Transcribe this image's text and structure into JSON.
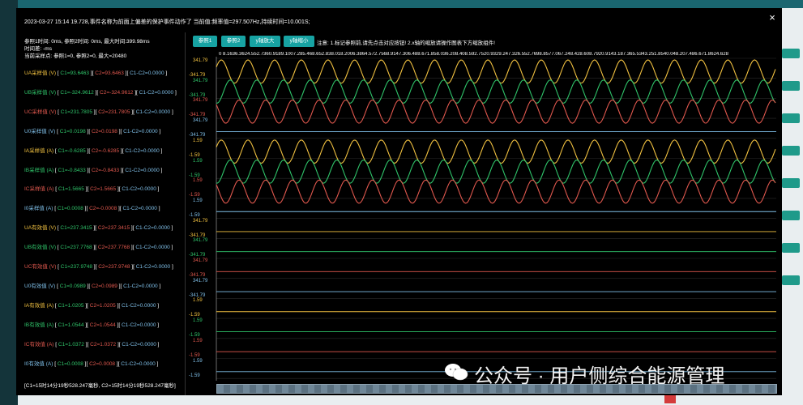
{
  "dialog": {
    "title": "2023-03-27 15:14 19.728,事件名称为前面上偏差的保护事件动作了 当前值:频率值=297.507Hz,持续时间=10.001S;",
    "close_label": "×",
    "info_lines": [
      "参照1时间:  0ms,  参照2时间:  0ms,  最大时间:399.98ms",
      "时间差:  -ms",
      "当前采样点:  参照1=0,  参照2=0,  最大=20480"
    ],
    "channels": [
      {
        "name": "UA采样值 (V)",
        "c1": "C1=93.6463",
        "c2": "C2=93.6463",
        "diff": "C1-C2=0.0000",
        "color": "#f0c040"
      },
      {
        "name": "UB采样值 (V)",
        "c1": "C1=-324.9612",
        "c2": "C2=-324.9612",
        "diff": "C1-C2=0.0000",
        "color": "#2fc46a"
      },
      {
        "name": "UC采样值 (V)",
        "c1": "C1=231.7805",
        "c2": "C2=231.7805",
        "diff": "C1-C2=0.0000",
        "color": "#e0584e"
      },
      {
        "name": "U0采样值 (V)",
        "c1": "C1=0.0198",
        "c2": "C2=0.0198",
        "diff": "C1-C2=0.0000",
        "color": "#7fbfe8"
      },
      {
        "name": "IA采样值 (A)",
        "c1": "C1=-0.6285",
        "c2": "C2=-0.6285",
        "diff": "C1-C2=0.0000",
        "color": "#f0c040"
      },
      {
        "name": "IB采样值 (A)",
        "c1": "C1=-0.8433",
        "c2": "C2=-0.8433",
        "diff": "C1-C2=0.0000",
        "color": "#2fc46a"
      },
      {
        "name": "IC采样值 (A)",
        "c1": "C1=1.5665",
        "c2": "C2=1.5665",
        "diff": "C1-C2=0.0000",
        "color": "#e0584e"
      },
      {
        "name": "I0采样值 (A)",
        "c1": "C1=0.0008",
        "c2": "C2=-0.0008",
        "diff": "C1-C2=0.0000",
        "color": "#7fbfe8"
      },
      {
        "name": "UA有效值 (V)",
        "c1": "C1=237.3415",
        "c2": "C2=237.3415",
        "diff": "C1-C2=0.0000",
        "color": "#f0c040"
      },
      {
        "name": "UB有效值 (V)",
        "c1": "C1=237.7768",
        "c2": "C2=237.7768",
        "diff": "C1-C2=0.0000",
        "color": "#2fc46a"
      },
      {
        "name": "UC有效值 (V)",
        "c1": "C1=237.9748",
        "c2": "C2=237.9748",
        "diff": "C1-C2=0.0000",
        "color": "#e0584e"
      },
      {
        "name": "U0有效值 (V)",
        "c1": "C1=0.0989",
        "c2": "C2=0.0989",
        "diff": "C1-C2=0.0000",
        "color": "#7fbfe8"
      },
      {
        "name": "IA有效值 (A)",
        "c1": "C1=1.0205",
        "c2": "C2=1.0205",
        "diff": "C1-C2=0.0000",
        "color": "#f0c040"
      },
      {
        "name": "IB有效值 (A)",
        "c1": "C1=1.0544",
        "c2": "C2=1.0544",
        "diff": "C1-C2=0.0000",
        "color": "#2fc46a"
      },
      {
        "name": "IC有效值 (A)",
        "c1": "C1=1.0372",
        "c2": "C2=1.0372",
        "diff": "C1-C2=0.0000",
        "color": "#e0584e"
      },
      {
        "name": "I0有效值 (A)",
        "c1": "C1=0.0008",
        "c2": "C2=0.0008",
        "diff": "C1-C2=0.0000",
        "color": "#7fbfe8"
      }
    ],
    "bottom_text": "[C1=15时14分19秒528.247毫秒,  C2=15时14分19秒528.247毫秒]",
    "toolbar": {
      "ref1": "参照1",
      "ref2": "参照2",
      "y_zoom_in": "y轴放大",
      "y_zoom_out": "y轴缩小",
      "note": "注意: 1.标记参照前,请先点击对应按钮! 2.x轴的缩放请操作图表下方缩放组件!"
    },
    "x_axis_text": "0  8.1636.3624.552.7360.9189.1007.285.468.652.838.018.2006.3864.572.7568.9147.306.488.671.858.036.208.408.592.7520.9329.247.326.552.7698.8577.067.248.428.608.7920.9143.187.365.5343.251.8540.048.207.486.671.8624.628",
    "y_labels": [
      {
        "text": "341.79",
        "color": "#f0c040"
      },
      {
        "text": "-341.79",
        "color": "#f0c040"
      },
      {
        "text": "341.79",
        "color": "#2fc46a"
      },
      {
        "text": "-341.79",
        "color": "#2fc46a"
      },
      {
        "text": "341.79",
        "color": "#e0584e"
      },
      {
        "text": "-341.79",
        "color": "#e0584e"
      },
      {
        "text": "341.79",
        "color": "#7fbfe8"
      },
      {
        "text": "-341.79",
        "color": "#7fbfe8"
      },
      {
        "text": "1.59",
        "color": "#f0c040"
      },
      {
        "text": "-1.59",
        "color": "#f0c040"
      },
      {
        "text": "1.59",
        "color": "#2fc46a"
      },
      {
        "text": "-1.59",
        "color": "#2fc46a"
      },
      {
        "text": "1.59",
        "color": "#e0584e"
      },
      {
        "text": "-1.59",
        "color": "#e0584e"
      },
      {
        "text": "1.59",
        "color": "#7fbfe8"
      },
      {
        "text": "-1.59",
        "color": "#7fbfe8"
      },
      {
        "text": "341.79",
        "color": "#f0c040"
      },
      {
        "text": "-341.79",
        "color": "#f0c040"
      },
      {
        "text": "341.79",
        "color": "#2fc46a"
      },
      {
        "text": "-341.79",
        "color": "#2fc46a"
      },
      {
        "text": "341.79",
        "color": "#e0584e"
      },
      {
        "text": "-341.79",
        "color": "#e0584e"
      },
      {
        "text": "341.79",
        "color": "#7fbfe8"
      },
      {
        "text": "-341.79",
        "color": "#7fbfe8"
      },
      {
        "text": "1.59",
        "color": "#f0c040"
      },
      {
        "text": "-1.59",
        "color": "#f0c040"
      },
      {
        "text": "1.59",
        "color": "#2fc46a"
      },
      {
        "text": "-1.59",
        "color": "#2fc46a"
      },
      {
        "text": "1.59",
        "color": "#e0584e"
      },
      {
        "text": "-1.59",
        "color": "#e0584e"
      },
      {
        "text": "1.59",
        "color": "#7fbfe8"
      },
      {
        "text": "-1.59",
        "color": "#7fbfe8"
      }
    ]
  },
  "watermark": "公众号 · 用户侧综合能源管理",
  "colors": {
    "accent": "#17a3a3",
    "yellow": "#f0c040",
    "green": "#2fc46a",
    "red": "#e0584e",
    "blue": "#7fbfe8"
  }
}
